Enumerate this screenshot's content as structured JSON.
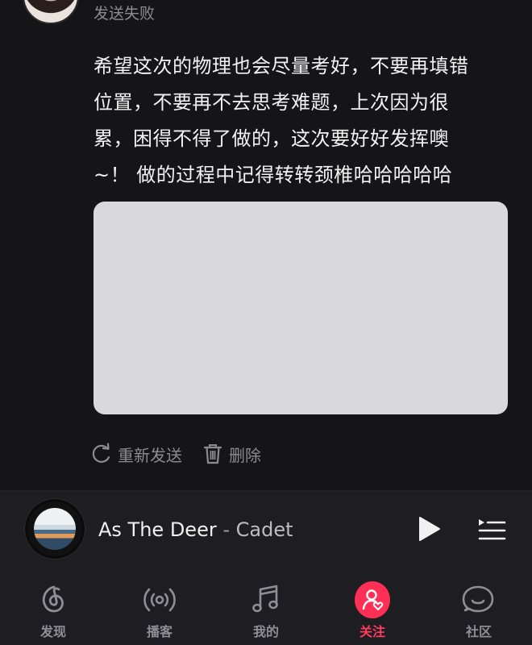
{
  "post": {
    "status": "发送失败",
    "text_lines": [
      "希望这次的物理也会尽量考好，不要再填错",
      "位置，不要再不去思考难题，上次因为很",
      "累，困得不得了做的，这次要好好发挥噢",
      "~！ 做的过程中记得转转颈椎哈哈哈哈哈"
    ],
    "resend_label": "重新发送",
    "delete_label": "删除"
  },
  "player": {
    "title": "As The Deer",
    "separator": " - ",
    "artist": "Cadet"
  },
  "nav": {
    "items": [
      {
        "label": "发现",
        "icon": "discover-icon"
      },
      {
        "label": "播客",
        "icon": "podcast-icon"
      },
      {
        "label": "我的",
        "icon": "music-note-icon"
      },
      {
        "label": "关注",
        "icon": "follow-icon",
        "active": true
      },
      {
        "label": "社区",
        "icon": "community-icon"
      }
    ]
  },
  "colors": {
    "background": "#151517",
    "bar": "#1e1e22",
    "accent": "#ff2f56",
    "muted": "#8c8c90"
  }
}
